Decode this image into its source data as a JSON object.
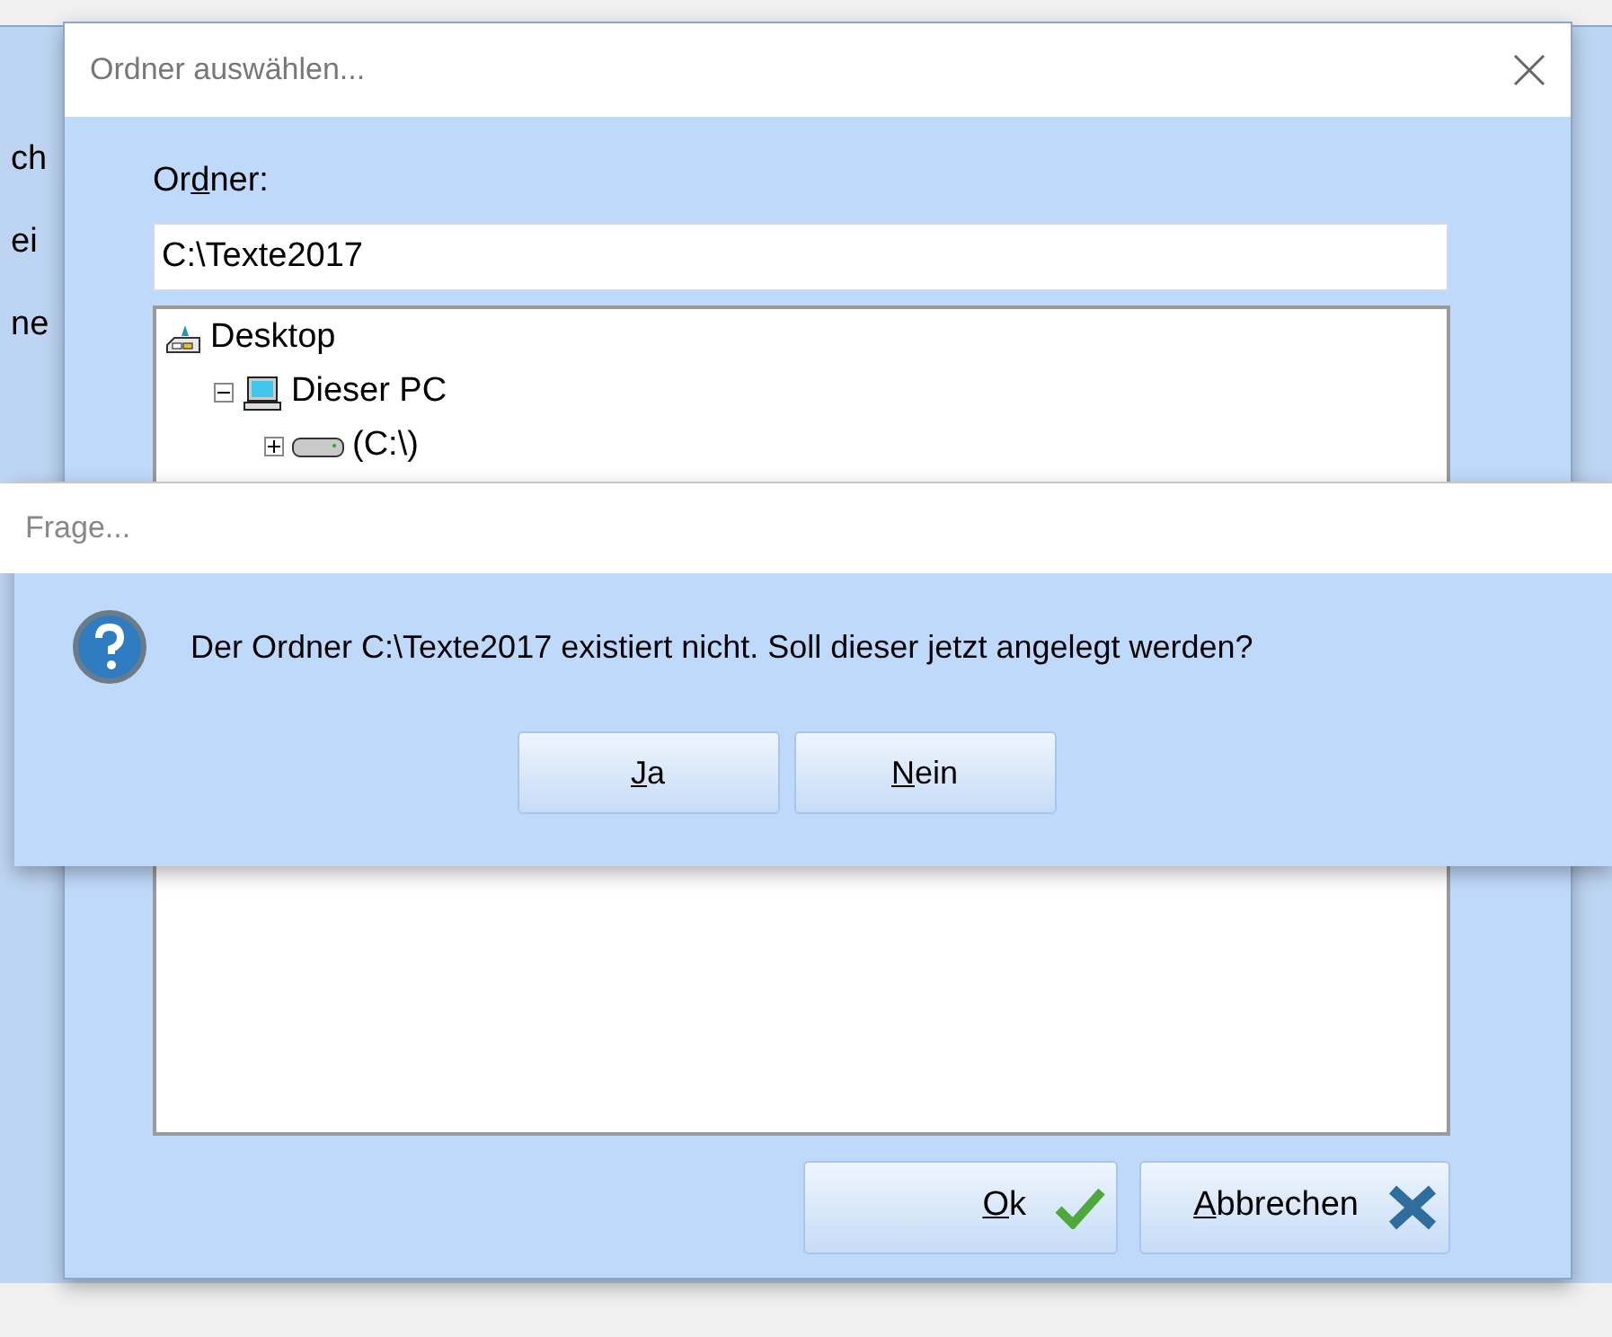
{
  "background_window": {
    "labels": [
      "ch",
      "ei",
      "ne"
    ]
  },
  "folder_dialog": {
    "title": "Ordner auswählen...",
    "folder_label_parts": {
      "before": "Or",
      "key": "d",
      "rest": "ner:"
    },
    "folder_value": "C:\\Texte2017",
    "tree": [
      {
        "label": "Desktop",
        "kind": "desktop",
        "children": [
          {
            "label": "Dieser PC",
            "kind": "computer",
            "expanded": true,
            "children": [
              {
                "label": "(C:\\)",
                "kind": "drive",
                "expanded": false
              }
            ]
          }
        ]
      }
    ],
    "buttons": [
      {
        "parts": {
          "key": "O",
          "rest": "k"
        },
        "kind": "ok"
      },
      {
        "parts": {
          "key": "A",
          "rest": "bbrechen"
        },
        "kind": "cancel"
      }
    ]
  },
  "question_dialog": {
    "title": "Frage...",
    "message": "Der Ordner C:\\Texte2017 existiert nicht. Soll dieser jetzt angelegt werden?",
    "buttons": [
      {
        "parts": {
          "key": "J",
          "rest": "a"
        }
      },
      {
        "parts": {
          "key": "N",
          "rest": "ein"
        }
      }
    ]
  }
}
